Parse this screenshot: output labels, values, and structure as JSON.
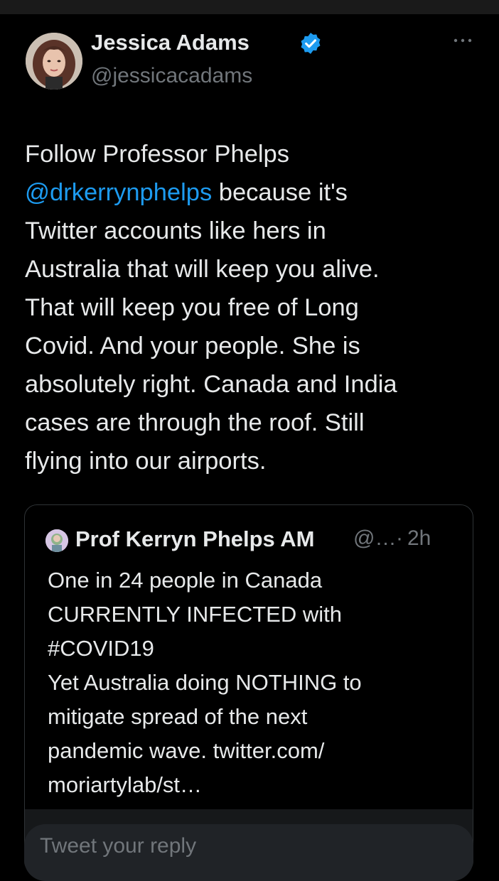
{
  "author": {
    "display_name": "Jessica Adams",
    "handle": "@jessicacadams",
    "verified_icon": "verified-badge-icon",
    "more_icon": "more-options-icon"
  },
  "tweet": {
    "lines": [
      "Follow Professor Phelps",
      "@drkerrynphelps",
      " because it's",
      "Twitter accounts like hers in",
      "Australia that will keep you alive.",
      "That will keep you free of Long",
      "Covid. And your people. She is",
      "absolutely right. Canada and India",
      "cases are through the roof. Still",
      "flying into our airports."
    ]
  },
  "quote": {
    "display_name": "Prof Kerryn Phelps AM",
    "handle": "@…",
    "separator": "·",
    "time": "2h",
    "lines": [
      "One in 24 people in Canada",
      "CURRENTLY INFECTED with",
      "#COVID19",
      "Yet Australia doing NOTHING to",
      "mitigate spread of the next",
      "pandemic wave. twitter.com/",
      "moriartylab/st…"
    ]
  },
  "reply": {
    "placeholder": "Tweet your reply"
  },
  "colors": {
    "background": "#000000",
    "text": "#e7e9ea",
    "secondary": "#71767b",
    "accent": "#1d9bf0"
  }
}
